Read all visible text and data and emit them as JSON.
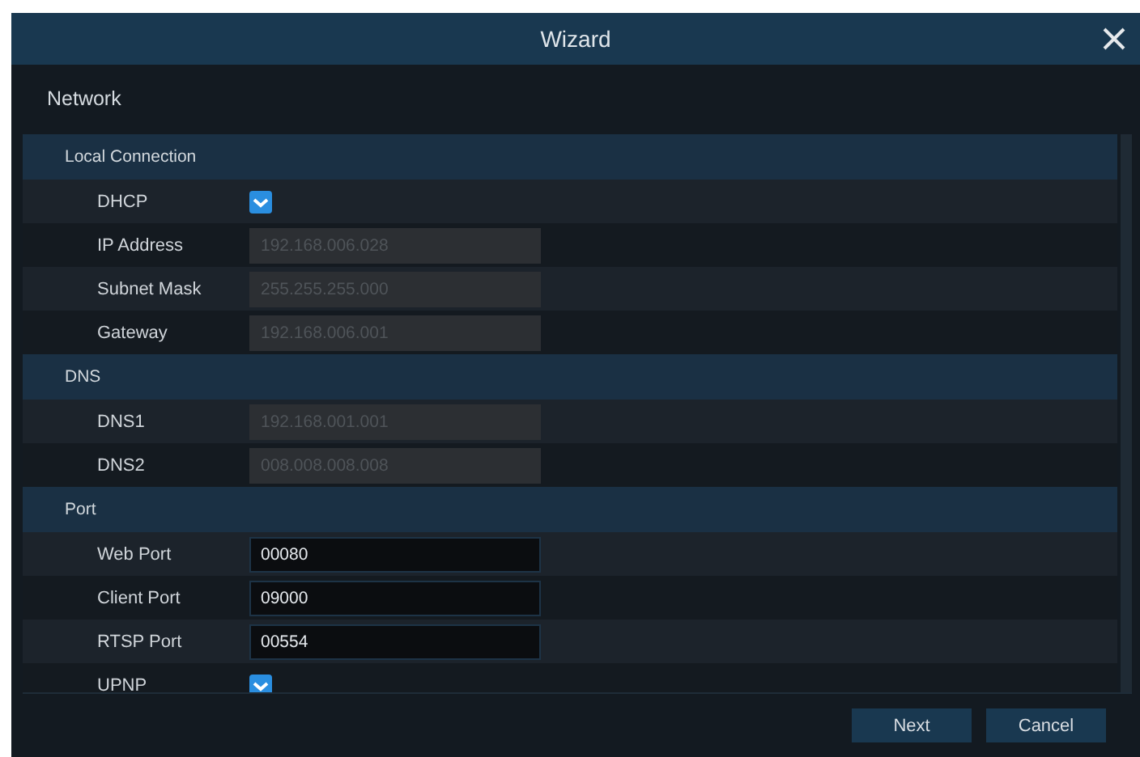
{
  "window": {
    "title": "Wizard"
  },
  "page": {
    "title": "Network"
  },
  "sections": [
    {
      "title": "Local Connection",
      "rows": [
        {
          "kind": "checkbox",
          "label": "DHCP",
          "checked": true
        },
        {
          "kind": "field",
          "label": "IP Address",
          "value": "192.168.006.028",
          "disabled": true
        },
        {
          "kind": "field",
          "label": "Subnet Mask",
          "value": "255.255.255.000",
          "disabled": true
        },
        {
          "kind": "field",
          "label": "Gateway",
          "value": "192.168.006.001",
          "disabled": true
        }
      ]
    },
    {
      "title": "DNS",
      "rows": [
        {
          "kind": "field",
          "label": "DNS1",
          "value": "192.168.001.001",
          "disabled": true
        },
        {
          "kind": "field",
          "label": "DNS2",
          "value": "008.008.008.008",
          "disabled": true
        }
      ]
    },
    {
      "title": "Port",
      "rows": [
        {
          "kind": "field",
          "label": "Web Port",
          "value": "00080",
          "disabled": false
        },
        {
          "kind": "field",
          "label": "Client Port",
          "value": "09000",
          "disabled": false
        },
        {
          "kind": "field",
          "label": "RTSP Port",
          "value": "00554",
          "disabled": false
        },
        {
          "kind": "checkbox",
          "label": "UPNP",
          "checked": true
        }
      ]
    }
  ],
  "buttons": [
    "Next",
    "Cancel"
  ]
}
